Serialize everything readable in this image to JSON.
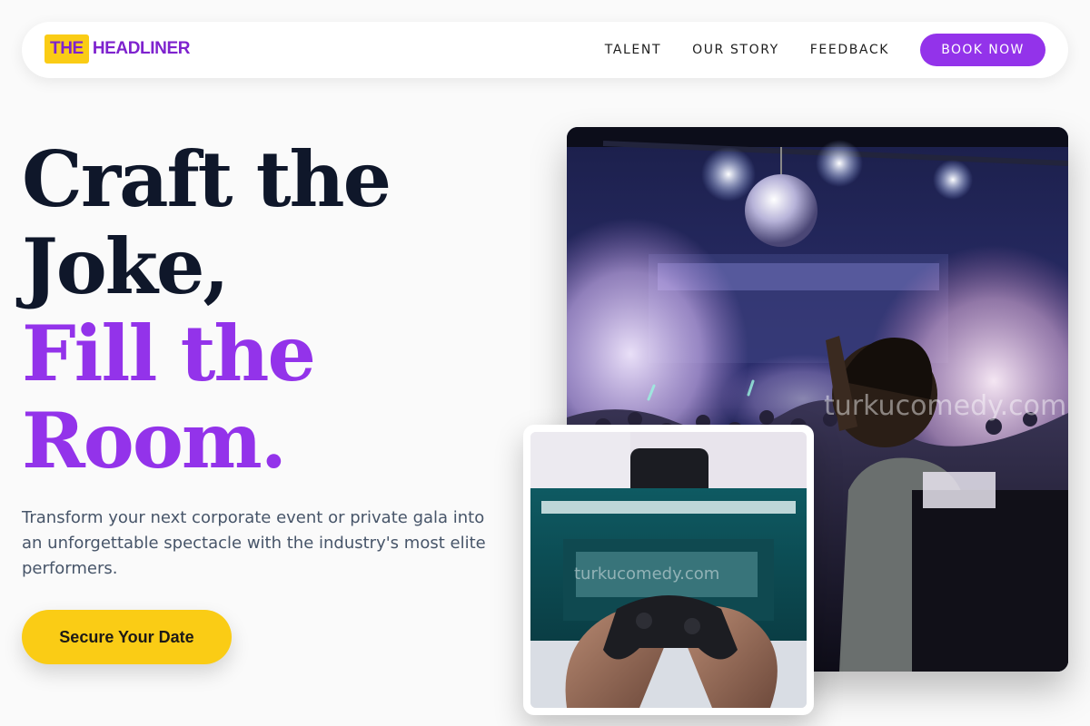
{
  "brand": {
    "logo_part1": "THE",
    "logo_part2": "HEADLINER",
    "accent_color": "#9333ea",
    "highlight_color": "#facc15"
  },
  "nav": {
    "links": [
      "TALENT",
      "OUR STORY",
      "FEEDBACK"
    ],
    "cta_label": "BOOK NOW"
  },
  "hero": {
    "headline_line1": "Craft the",
    "headline_line2": "Joke,",
    "headline_line3": "Fill the",
    "headline_line4": "Room.",
    "subtext": "Transform your next corporate event or private gala into an unforgettable spectacle with the industry's most elite performers.",
    "cta_label": "Secure Your Date"
  },
  "images": {
    "main_watermark": "turkucomedy.com",
    "small_watermark": "turkucomedy.com"
  }
}
